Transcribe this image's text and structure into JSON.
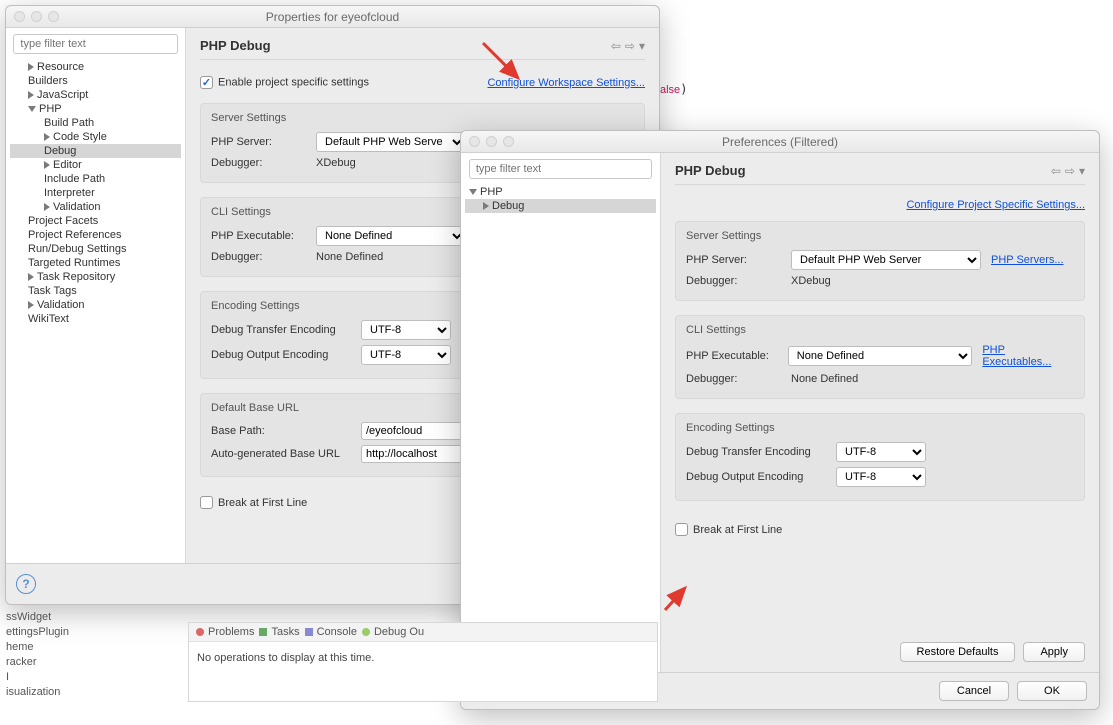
{
  "bg": {
    "code_token": "alse",
    "side_items": [
      "ssWidget",
      "ettingsPlugin",
      "heme",
      "racker",
      "I",
      "isualization"
    ],
    "tabs": [
      "Problems",
      "Tasks",
      "Console",
      "Debug Ou"
    ],
    "tabs_msg": "No operations to display at this time."
  },
  "props": {
    "title": "Properties for eyeofcloud",
    "filter_placeholder": "type filter text",
    "page_title": "PHP Debug",
    "enable_label": "Enable project specific settings",
    "configure_link": "Configure Workspace Settings...",
    "tree": {
      "n0": "Resource",
      "n1": "Builders",
      "n2": "JavaScript",
      "n3": "PHP",
      "n3a": "Build Path",
      "n3b": "Code Style",
      "n3c": "Debug",
      "n3d": "Editor",
      "n3e": "Include Path",
      "n3f": "Interpreter",
      "n3g": "Validation",
      "n4": "Project Facets",
      "n5": "Project References",
      "n6": "Run/Debug Settings",
      "n7": "Targeted Runtimes",
      "n8": "Task Repository",
      "n9": "Task Tags",
      "n10": "Validation",
      "n11": "WikiText"
    },
    "server": {
      "title": "Server Settings",
      "php_server_label": "PHP Server:",
      "php_server_value": "Default PHP Web Serve",
      "debugger_label": "Debugger:",
      "debugger_value": "XDebug"
    },
    "cli": {
      "title": "CLI Settings",
      "exec_label": "PHP Executable:",
      "exec_value": "None Defined",
      "debugger_label": "Debugger:",
      "debugger_value": "None Defined"
    },
    "enc": {
      "title": "Encoding Settings",
      "transfer_label": "Debug Transfer Encoding",
      "transfer_value": "UTF-8",
      "output_label": "Debug Output Encoding",
      "output_value": "UTF-8"
    },
    "base": {
      "title": "Default Base URL",
      "path_label": "Base Path:",
      "path_value": "/eyeofcloud",
      "auto_label": "Auto-generated Base URL",
      "auto_value": "http://localhost"
    },
    "break_label": "Break at First Line"
  },
  "prefs": {
    "title": "Preferences (Filtered)",
    "filter_placeholder": "type filter text",
    "page_title": "PHP Debug",
    "configure_link": "Configure Project Specific Settings...",
    "tree": {
      "n0": "PHP",
      "n1": "Debug"
    },
    "server": {
      "title": "Server Settings",
      "php_server_label": "PHP Server:",
      "php_server_value": "Default PHP Web Server",
      "servers_link": "PHP Servers...",
      "debugger_label": "Debugger:",
      "debugger_value": "XDebug"
    },
    "cli": {
      "title": "CLI Settings",
      "exec_label": "PHP Executable:",
      "exec_value": "None Defined",
      "exec_link": "PHP Executables...",
      "debugger_label": "Debugger:",
      "debugger_value": "None Defined"
    },
    "enc": {
      "title": "Encoding Settings",
      "transfer_label": "Debug Transfer Encoding",
      "transfer_value": "UTF-8",
      "output_label": "Debug Output Encoding",
      "output_value": "UTF-8"
    },
    "break_label": "Break at First Line",
    "buttons": {
      "restore": "Restore Defaults",
      "apply": "Apply",
      "cancel": "Cancel",
      "ok": "OK"
    }
  }
}
